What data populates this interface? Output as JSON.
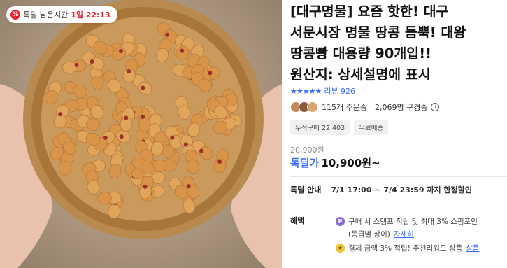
{
  "timer": {
    "icon": "percent-icon",
    "label": "톡딜 남은시간",
    "value": "1일 22:13"
  },
  "product": {
    "title_lines": [
      "[대구명물] 요즘 핫한! 대구",
      "서문시장 명물 땅콩 듬뿍! 대왕",
      "땅콩빵 대용량 90개입!!",
      "원산지: 상세설명에 표시"
    ],
    "stars": "★★★★★",
    "review_text": "리뷰 926",
    "orders": "115개 주문중",
    "viewers": "2,069명 구경중",
    "tags": [
      "누적구매 22,403",
      "무료배송"
    ],
    "original_price": "20,900원",
    "deal_label": "톡딜가",
    "price": "10,900원~",
    "deal_info_label": "톡딜 안내",
    "deal_info_value": "7/1 17:00 ~ 7/4 23:59 까지 한정할인",
    "benefit_label": "혜택",
    "benefits": [
      "구매 시 스탬프 적립 및 최대 3% 쇼핑포인",
      "(등급별 상이)",
      "자세히",
      "결제 금액 3% 적립! 추천리워드 상품",
      "상품"
    ]
  },
  "colors": {
    "accent_blue": "#346aff",
    "timer_red": "#e8242f"
  }
}
